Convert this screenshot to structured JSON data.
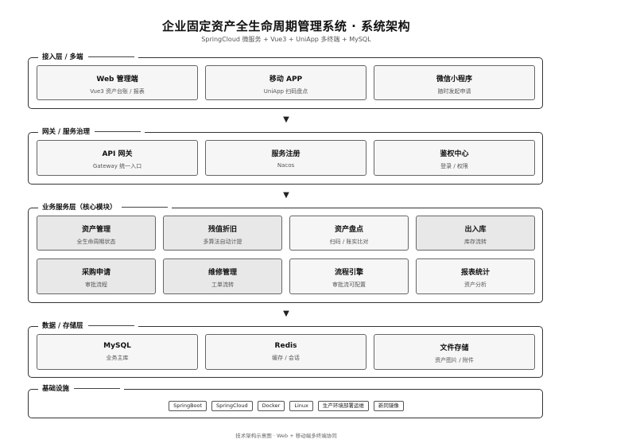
{
  "title": "企业固定资产全生命周期管理系统 · 系统架构",
  "subtitle": "SpringCloud 微服务 + Vue3 + UniApp 多终端 + MySQL",
  "arrow_glyph": "▼",
  "layers": {
    "access": {
      "label": "接入层 / 多端",
      "cards": [
        {
          "title": "Web 管理端",
          "sub": "Vue3 资产台账 / 报表"
        },
        {
          "title": "移动 APP",
          "sub": "UniApp 扫码盘点"
        },
        {
          "title": "微信小程序",
          "sub": "随时发起申请"
        }
      ]
    },
    "gateway": {
      "label": "网关 / 服务治理",
      "cards": [
        {
          "title": "API 网关",
          "sub": "Gateway 统一入口"
        },
        {
          "title": "服务注册",
          "sub": "Nacos"
        },
        {
          "title": "鉴权中心",
          "sub": "登录 / 权限"
        }
      ]
    },
    "business": {
      "label": "业务服务层（核心模块）",
      "cards": [
        {
          "title": "资产管理",
          "sub": "全生命周期状态"
        },
        {
          "title": "残值折旧",
          "sub": "多算法自动计提"
        },
        {
          "title": "资产盘点",
          "sub": "扫码 / 账实比对"
        },
        {
          "title": "出入库",
          "sub": "库存流转"
        },
        {
          "title": "采购申请",
          "sub": "审批流程"
        },
        {
          "title": "维修管理",
          "sub": "工单流转"
        },
        {
          "title": "流程引擎",
          "sub": "审批流可配置"
        },
        {
          "title": "报表统计",
          "sub": "资产分析"
        }
      ]
    },
    "data": {
      "label": "数据 / 存储层",
      "cards": [
        {
          "title": "MySQL",
          "sub": "业务主库"
        },
        {
          "title": "Redis",
          "sub": "缓存 / 会话"
        },
        {
          "title": "文件存储",
          "sub": "资产图片 / 附件"
        }
      ]
    },
    "infra": {
      "label": "基础设施",
      "tags": [
        "SpringBoot",
        "SpringCloud",
        "Docker",
        "Linux",
        "生产环境部署运维",
        "新同镜像"
      ]
    }
  },
  "footer": "技术架构示意图 · Web + 移动端多终端协同"
}
